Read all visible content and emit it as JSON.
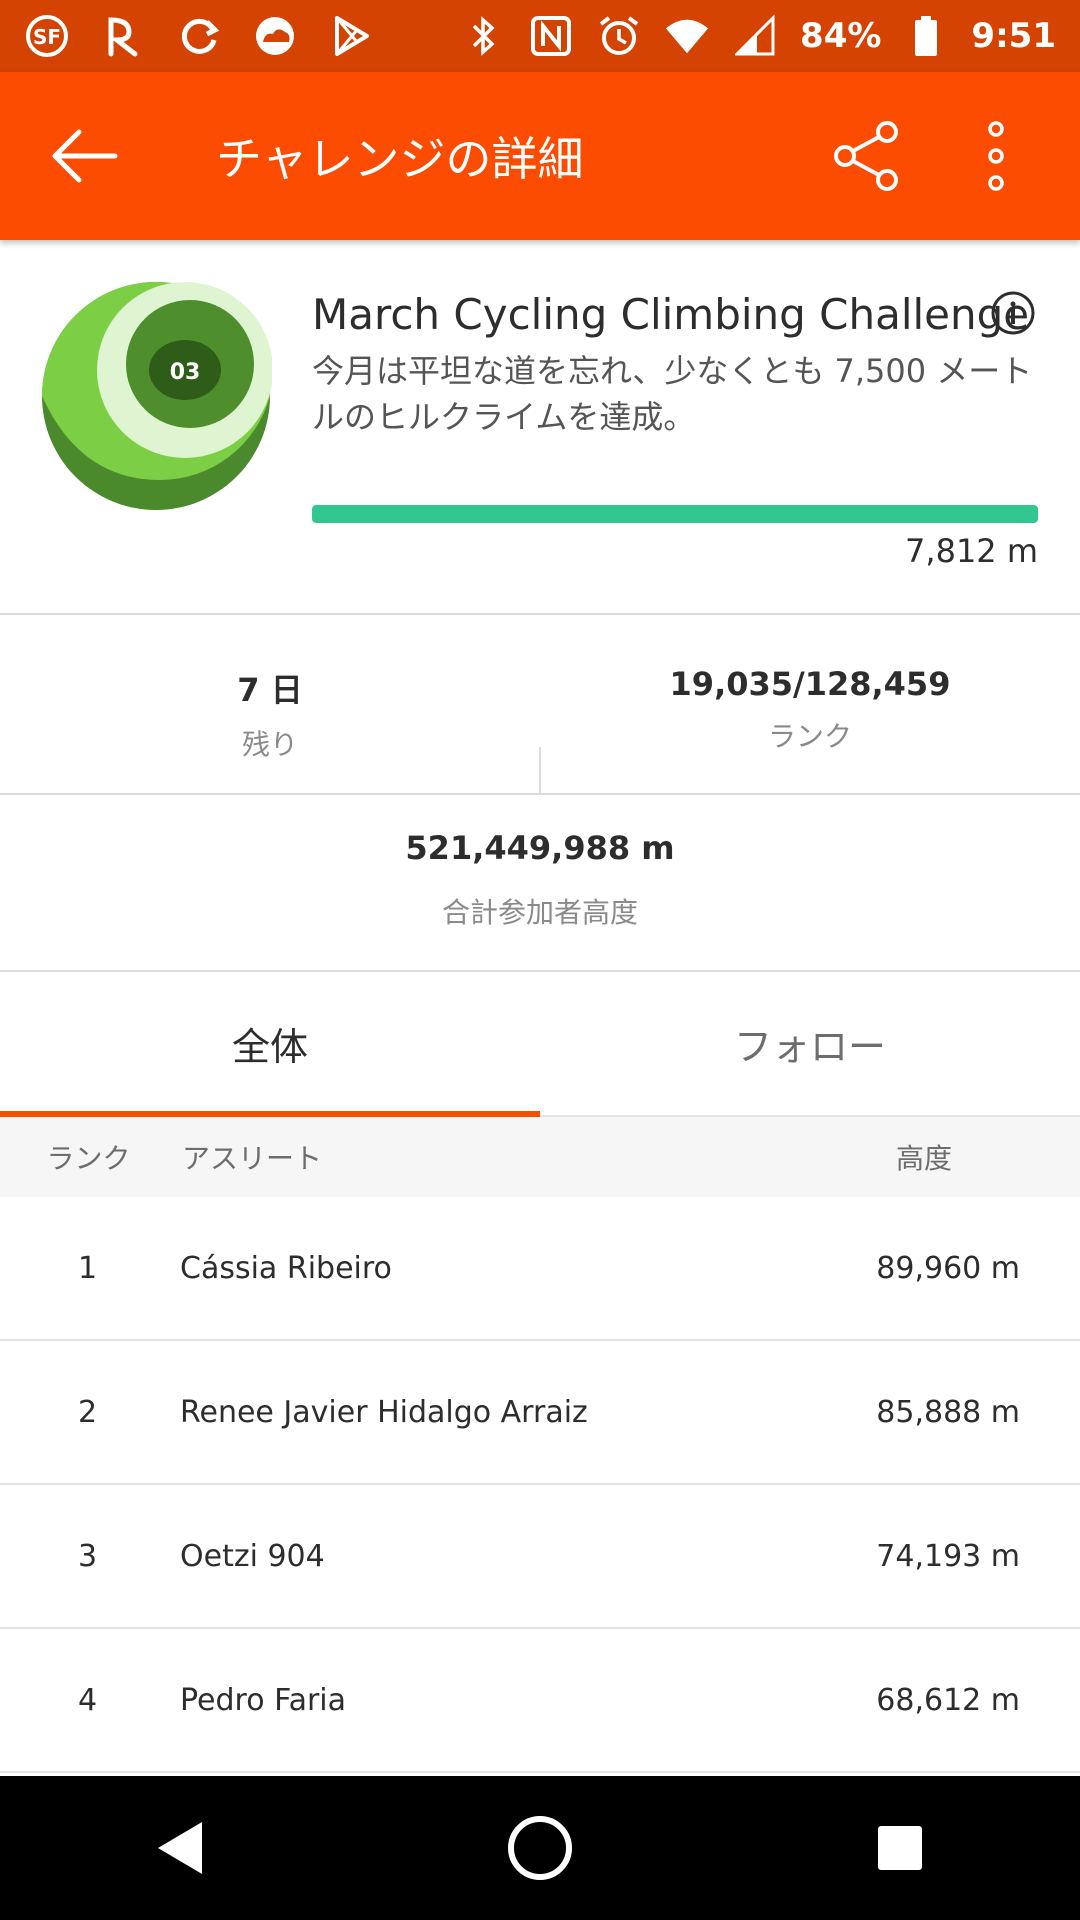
{
  "status_bar": {
    "battery": "84%",
    "time": "9:51",
    "left_icons": [
      "sf-icon",
      "route-icon",
      "sync-icon",
      "cloud-icon",
      "play-store-icon"
    ],
    "right_icons": [
      "bluetooth-icon",
      "nfc-icon",
      "alarm-icon",
      "wifi-icon",
      "signal-icon",
      "battery-icon"
    ]
  },
  "app_bar": {
    "title": "チャレンジの詳細",
    "back_icon": "arrow-left-icon",
    "share_icon": "share-icon",
    "more_icon": "more-vert-icon",
    "color": "#fc4c02"
  },
  "challenge": {
    "title": "March Cycling Climbing Challenge",
    "badge_label": "03",
    "description": "今月は平坦な道を忘れ、少なくとも 7,500 メートルのヒルクライムを達成。",
    "progress_fraction": 1.0,
    "progress_text": "7,812 m",
    "progress_color": "#32c791"
  },
  "stats": {
    "days_value": "7 日",
    "days_label": "残り",
    "rank_value": "19,035/128,459",
    "rank_label": "ランク",
    "total_value": "521,449,988 m",
    "total_label": "合計参加者高度"
  },
  "tabs": [
    {
      "label": "全体",
      "active": true
    },
    {
      "label": "フォロー",
      "active": false
    }
  ],
  "leaderboard": {
    "headers": {
      "rank": "ランク",
      "athlete": "アスリート",
      "elevation": "高度"
    },
    "rows": [
      {
        "rank": "1",
        "athlete": "Cássia Ribeiro",
        "elevation": "89,960 m"
      },
      {
        "rank": "2",
        "athlete": "Renee Javier Hidalgo Arraiz",
        "elevation": "85,888 m"
      },
      {
        "rank": "3",
        "athlete": "Oetzi 904",
        "elevation": "74,193 m"
      },
      {
        "rank": "4",
        "athlete": "Pedro Faria",
        "elevation": "68,612 m"
      }
    ]
  },
  "nav_bar": {
    "icons": [
      "back-triangle-icon",
      "home-circle-icon",
      "recents-square-icon"
    ]
  }
}
